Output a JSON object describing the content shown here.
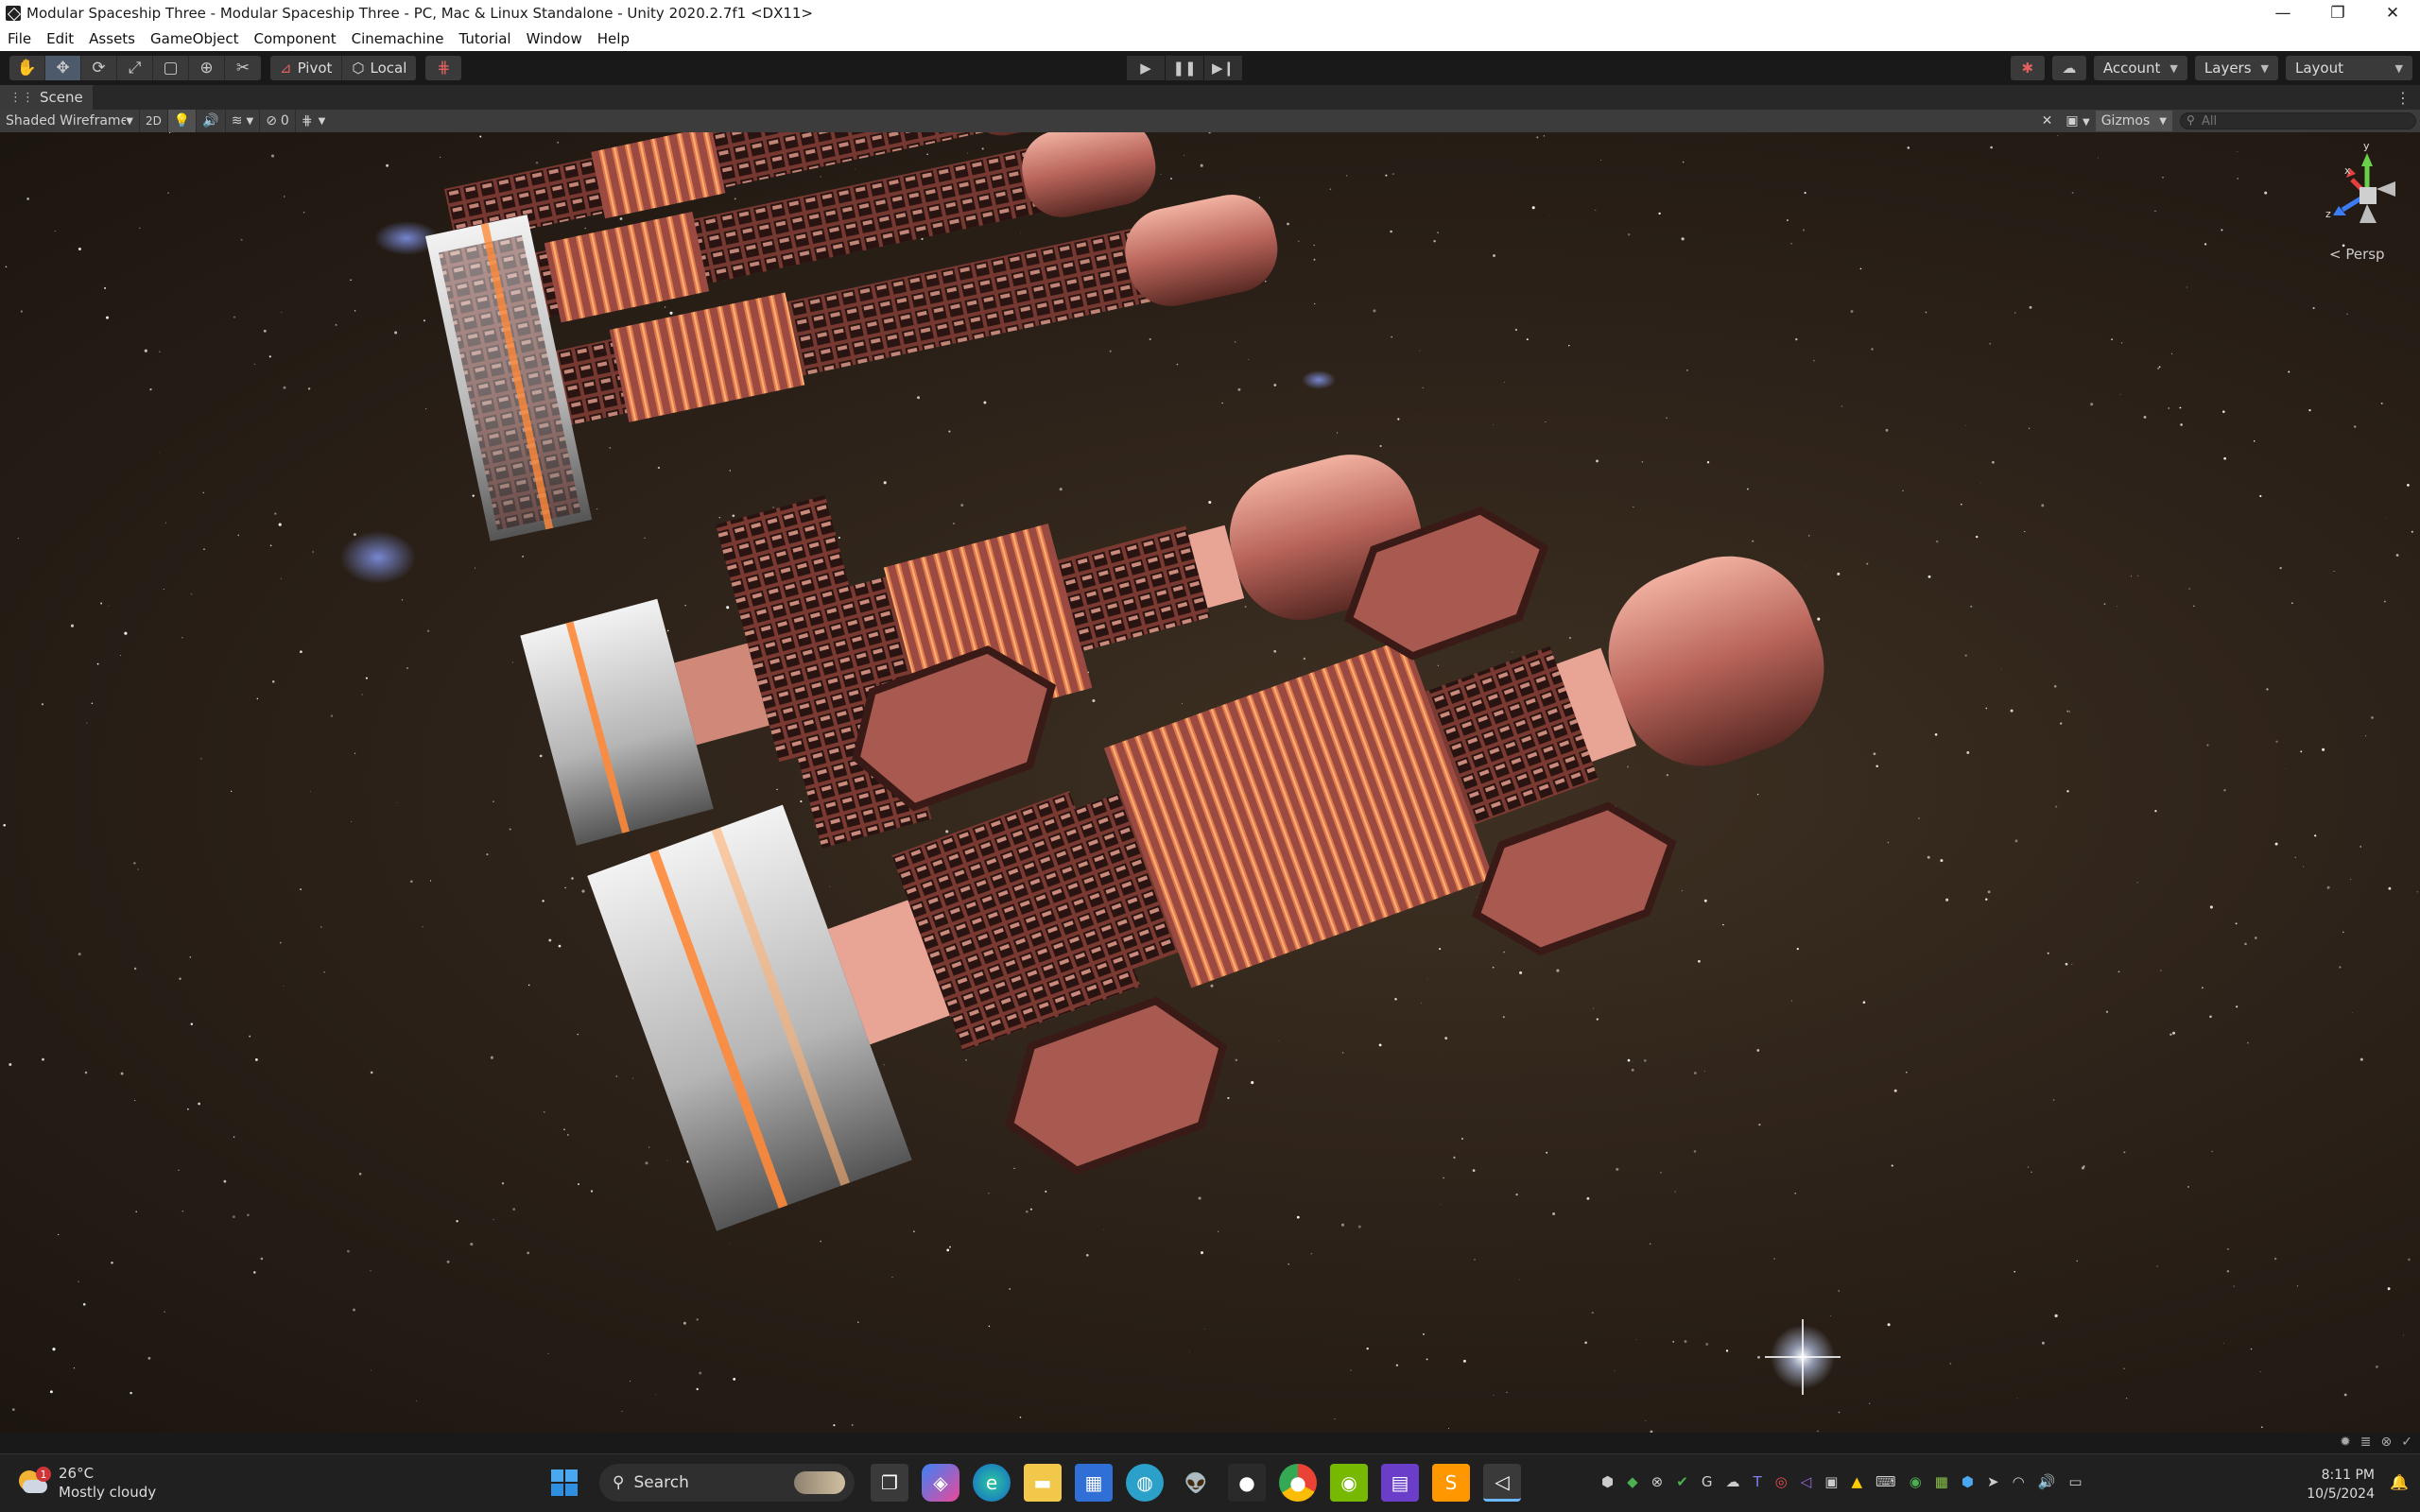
{
  "window": {
    "title": "Modular Spaceship Three - Modular Spaceship Three - PC, Mac & Linux Standalone - Unity 2020.2.7f1 <DX11>",
    "minimize": "—",
    "maximize": "❐",
    "close": "✕"
  },
  "menu": [
    "File",
    "Edit",
    "Assets",
    "GameObject",
    "Component",
    "Cinemachine",
    "Tutorial",
    "Window",
    "Help"
  ],
  "toolbar": {
    "tools": [
      "hand-tool",
      "move-tool",
      "rotate-tool",
      "scale-tool",
      "rect-tool",
      "transform-tool",
      "custom-tool"
    ],
    "pivot_label": "Pivot",
    "local_label": "Local",
    "account_label": "Account",
    "layers_label": "Layers",
    "layout_label": "Layout"
  },
  "scene": {
    "tab_label": "Scene",
    "shading_mode": "Shaded Wireframe",
    "mode_2d": "2D",
    "hidden_count": "0",
    "gizmos_label": "Gizmos",
    "search_placeholder": "All",
    "persp_label": "< Persp",
    "axis_labels": {
      "y": "y",
      "x": "x",
      "z": "z"
    }
  },
  "taskbar": {
    "weather_temp": "26°C",
    "weather_desc": "Mostly cloudy",
    "weather_badge": "1",
    "search_label": "Search",
    "time": "8:11 PM",
    "date": "10/5/2024"
  },
  "colors": {
    "hull": "#b8645a",
    "hull_light": "#e8a596",
    "glow": "#ff8a3a",
    "panel_white": "#d8d8d8",
    "space": "#2a2018"
  }
}
